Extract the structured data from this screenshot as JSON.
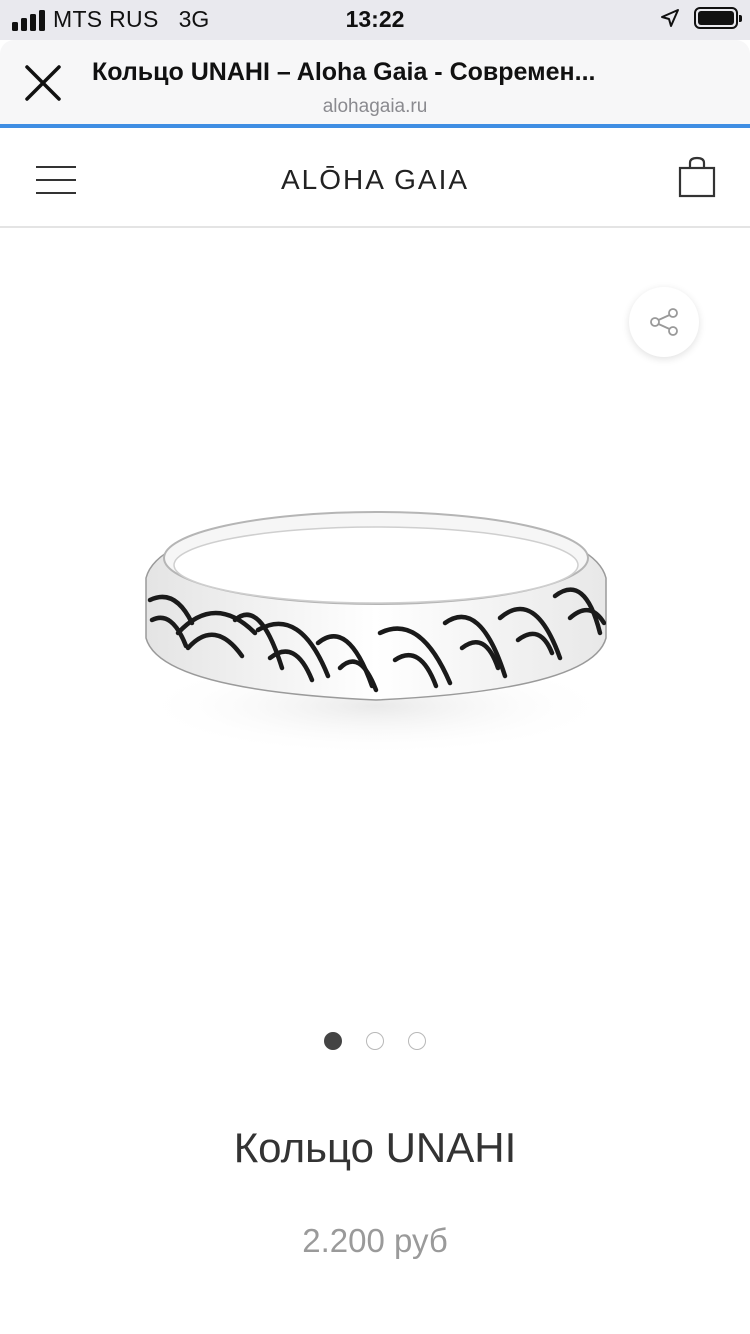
{
  "status_bar": {
    "carrier": "MTS RUS",
    "network": "3G",
    "time": "13:22",
    "signal_bars": 4,
    "battery_level": 1.0,
    "icons": [
      "signal-icon",
      "location-arrow-icon",
      "battery-icon"
    ]
  },
  "browser": {
    "page_title": "Кольцо UNAHI – Aloha Gaia - Современ...",
    "domain": "alohagaia.ru",
    "accent_color": "#3f8ee3",
    "close_icon": "close-icon"
  },
  "site": {
    "logo": "ALŌHA GAIA",
    "menu_icon": "hamburger-menu-icon",
    "cart_icon": "shopping-bag-icon"
  },
  "product": {
    "image": "silver-ring-wave-pattern",
    "share_icon": "share-icon",
    "gallery": {
      "count": 3,
      "active_index": 0
    },
    "title": "Кольцо UNAHI",
    "price": "2.200 руб"
  }
}
